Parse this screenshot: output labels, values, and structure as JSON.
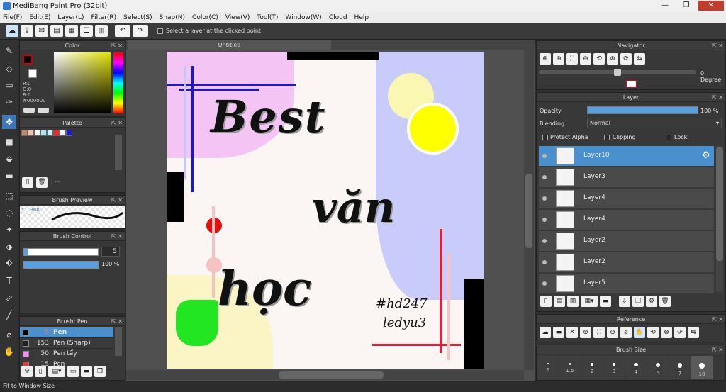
{
  "app": {
    "title": "MediBang Paint Pro (32bit)"
  },
  "menu": [
    "File(F)",
    "Edit(E)",
    "Layer(L)",
    "Filter(R)",
    "Select(S)",
    "Snap(N)",
    "Color(C)",
    "View(V)",
    "Tool(T)",
    "Window(W)",
    "Cloud",
    "Help"
  ],
  "toolbar": {
    "select_layer_label": "Select a layer at the clicked point"
  },
  "canvas": {
    "tab_title": "Untitled",
    "artwork_text": {
      "line1": "Best",
      "line2": "văn",
      "line3": "học",
      "tag1": "#hd247",
      "tag2": "ledyu3"
    }
  },
  "color_panel": {
    "title": "Color",
    "r": "R:0",
    "g": "G:0",
    "b": "B:0",
    "hex": "#000000",
    "primary": "#000000",
    "secondary": "#ffffff"
  },
  "palette_panel": {
    "title": "Palette",
    "colors": [
      "#c48a62",
      "#f4c2a0",
      "#ffffff",
      "#a8e6f0",
      "#d0f0ff",
      "#ff2020",
      "#f5f5f5",
      "#1a1ae6"
    ],
    "footer_label": "| ---"
  },
  "brush_preview": {
    "title": "Brush Preview",
    "size_label": "0.36n"
  },
  "brush_control": {
    "title": "Brush Control",
    "size_value": "5",
    "opacity_value": "100 %",
    "opacity": 1
  },
  "brush_list": {
    "title": "Brush: Pen",
    "items": [
      {
        "size": "5",
        "name": "Pen",
        "swatch": "#000000"
      },
      {
        "size": "153",
        "name": "Pen (Sharp)",
        "swatch": "#222222"
      },
      {
        "size": "50",
        "name": "Pen tẩy",
        "swatch": "#ff88ff"
      },
      {
        "size": "15",
        "name": "Pen",
        "swatch": "#ff3030"
      }
    ]
  },
  "navigator": {
    "title": "Navigator",
    "angle": "0 Degree"
  },
  "layer_panel": {
    "title": "Layer",
    "opacity_label": "Opacity",
    "opacity_value": "100 %",
    "blending_label": "Blending",
    "blending_value": "Normal",
    "protect_alpha": "Protect Alpha",
    "clipping": "Clipping",
    "lock": "Lock",
    "layers": [
      "Layer10",
      "Layer3",
      "Layer4",
      "Layer4",
      "Layer2",
      "Layer2",
      "Layer5"
    ]
  },
  "reference": {
    "title": "Reference"
  },
  "brush_size": {
    "title": "Brush Size",
    "sizes": [
      "1",
      "1.5",
      "2",
      "3",
      "4",
      "5",
      "7",
      "10"
    ]
  },
  "status": {
    "text": "Fit to Window Size"
  }
}
